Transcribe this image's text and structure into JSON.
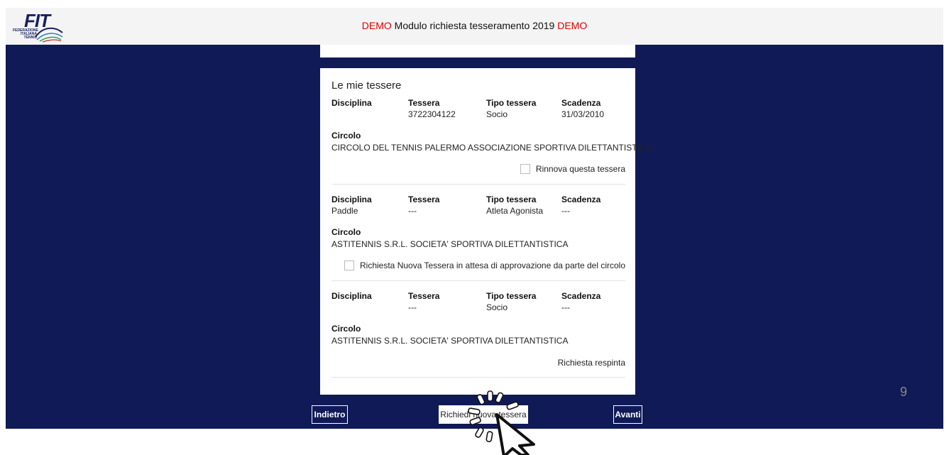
{
  "header": {
    "logo_text": "FIT",
    "logo_sub": "FEDERAZIONE ITALIANA TENNIS",
    "title_prefix": "DEMO",
    "title_main": " Modulo richiesta tesseramento 2019 ",
    "title_suffix": "DEMO"
  },
  "card": {
    "title": "Le mie tessere",
    "labels": {
      "disciplina": "Disciplina",
      "tessera": "Tessera",
      "tipo": "Tipo tessera",
      "scadenza": "Scadenza",
      "circolo": "Circolo"
    },
    "entries": [
      {
        "disciplina": "",
        "tessera": "3722304122",
        "tipo": "Socio",
        "scadenza": "31/03/2010",
        "circolo": "CIRCOLO DEL TENNIS PALERMO ASSOCIAZIONE SPORTIVA DILETTANTISTICA",
        "action_label": "Rinnova questa tessera"
      },
      {
        "disciplina": "Paddle",
        "tessera": "---",
        "tipo": "Atleta Agonista",
        "scadenza": "---",
        "circolo": "ASTITENNIS S.R.L. SOCIETA' SPORTIVA DILETTANTISTICA",
        "action_label": "Richiesta Nuova Tessera in attesa di approvazione da parte del circolo"
      },
      {
        "disciplina": "",
        "tessera": "---",
        "tipo": "Socio",
        "scadenza": "---",
        "circolo": "ASTITENNIS S.R.L. SOCIETA' SPORTIVA DILETTANTISTICA",
        "status": "Richiesta respinta"
      }
    ]
  },
  "buttons": {
    "back": "Indietro",
    "new": "Richiedi nuova tessera",
    "next": "Avanti"
  },
  "slide_number": "9",
  "colors": {
    "background": "#101a57",
    "accent_red": "#e00000"
  }
}
